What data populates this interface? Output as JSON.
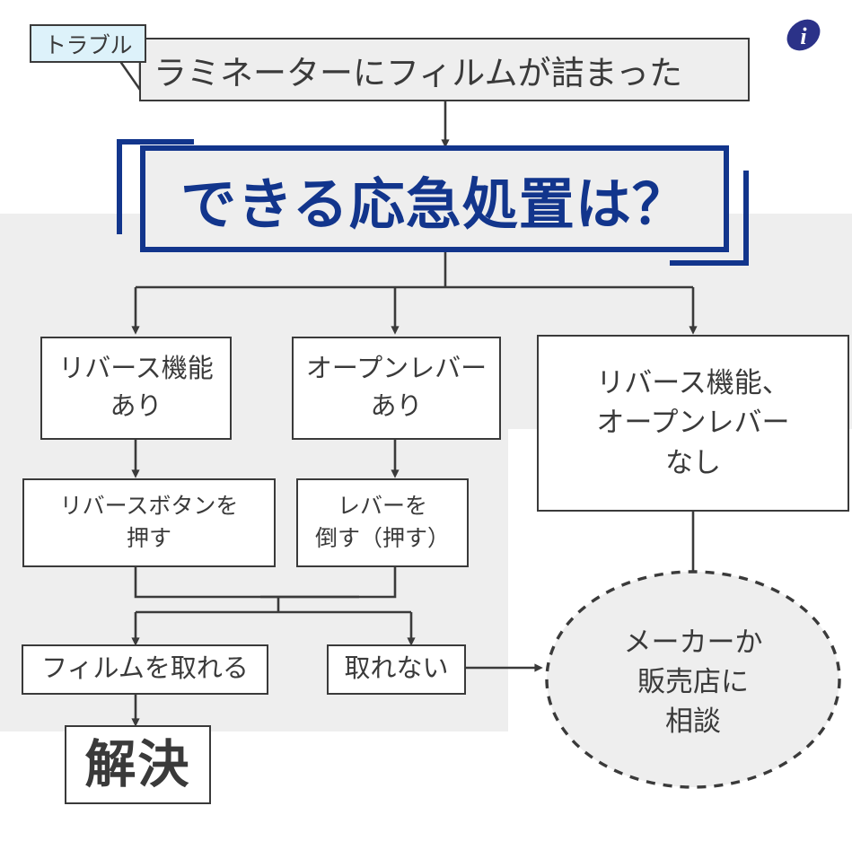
{
  "meta": {
    "title": "ラミネーターにフィルムが詰まった 応急処置フローチャート",
    "colors": {
      "panel_gray": "#eeeeee",
      "line_dark": "#3a3a3a",
      "accent_blue": "#12358c",
      "tag_blue_fill": "#ddf2fa",
      "white": "#ffffff"
    }
  },
  "tag": {
    "label": "トラブル"
  },
  "header": {
    "title": "ラミネーターにフィルムが詰まった"
  },
  "question": {
    "text": "できる応急処置は？"
  },
  "icons": {
    "info": "info-icon"
  },
  "nodes": {
    "branch_left": "リバース機能\nあり",
    "branch_middle": "オープンレバー\nあり",
    "branch_right": "リバース機能、\nオープンレバー\nなし",
    "action_left": "リバースボタンを\n押す",
    "action_middle": "レバーを\n倒す（押す）",
    "result_ok": "フィルムを取れる",
    "result_ng": "取れない",
    "end_solved": "解決",
    "end_consult": "メーカーか\n販売店に\n相談"
  },
  "chart_data": {
    "type": "flowchart",
    "title": "ラミネーターにフィルムが詰まった／できる応急処置は？",
    "nodes": [
      {
        "id": "tag",
        "label": "トラブル",
        "shape": "tag",
        "fill": "#ddf2fa",
        "stroke": "#3a3a3a"
      },
      {
        "id": "header",
        "label": "ラミネーターにフィルムが詰まった",
        "shape": "rect",
        "fill": "#eeeeee",
        "stroke": "#3a3a3a"
      },
      {
        "id": "question",
        "label": "できる応急処置は？",
        "shape": "rect-bracket",
        "fill": "#eeeeee",
        "stroke": "#12358c"
      },
      {
        "id": "branch_left",
        "label": "リバース機能あり",
        "shape": "rect",
        "fill": "#ffffff",
        "stroke": "#3a3a3a"
      },
      {
        "id": "branch_middle",
        "label": "オープンレバーあり",
        "shape": "rect",
        "fill": "#ffffff",
        "stroke": "#3a3a3a"
      },
      {
        "id": "branch_right",
        "label": "リバース機能、オープンレバーなし",
        "shape": "rect",
        "fill": "#ffffff",
        "stroke": "#3a3a3a"
      },
      {
        "id": "action_left",
        "label": "リバースボタンを押す",
        "shape": "rect",
        "fill": "#ffffff",
        "stroke": "#3a3a3a"
      },
      {
        "id": "action_middle",
        "label": "レバーを倒す（押す）",
        "shape": "rect",
        "fill": "#ffffff",
        "stroke": "#3a3a3a"
      },
      {
        "id": "result_ok",
        "label": "フィルムを取れる",
        "shape": "rect",
        "fill": "#ffffff",
        "stroke": "#3a3a3a"
      },
      {
        "id": "result_ng",
        "label": "取れない",
        "shape": "rect",
        "fill": "#ffffff",
        "stroke": "#3a3a3a"
      },
      {
        "id": "end_solved",
        "label": "解決",
        "shape": "rect",
        "fill": "#ffffff",
        "stroke": "#3a3a3a"
      },
      {
        "id": "end_consult",
        "label": "メーカーか販売店に相談",
        "shape": "ellipse-dashed",
        "fill": "#eeeeee",
        "stroke": "#3a3a3a"
      }
    ],
    "edges": [
      {
        "from": "header",
        "to": "question",
        "style": "solid",
        "arrow": true
      },
      {
        "from": "question",
        "to": "branch_left",
        "style": "solid",
        "arrow": true
      },
      {
        "from": "question",
        "to": "branch_middle",
        "style": "solid",
        "arrow": true
      },
      {
        "from": "question",
        "to": "branch_right",
        "style": "solid",
        "arrow": true
      },
      {
        "from": "branch_left",
        "to": "action_left",
        "style": "solid",
        "arrow": true
      },
      {
        "from": "branch_middle",
        "to": "action_middle",
        "style": "solid",
        "arrow": true
      },
      {
        "from": "branch_right",
        "to": "end_consult",
        "style": "solid",
        "arrow": true
      },
      {
        "from": "action_left",
        "to": "result_ok",
        "style": "solid",
        "arrow": true
      },
      {
        "from": "action_left",
        "to": "result_ng",
        "style": "solid",
        "arrow": true
      },
      {
        "from": "action_middle",
        "to": "result_ok",
        "style": "solid",
        "arrow": true
      },
      {
        "from": "action_middle",
        "to": "result_ng",
        "style": "solid",
        "arrow": true
      },
      {
        "from": "result_ok",
        "to": "end_solved",
        "style": "solid",
        "arrow": true
      },
      {
        "from": "result_ng",
        "to": "end_consult",
        "style": "solid",
        "arrow": true
      }
    ]
  }
}
